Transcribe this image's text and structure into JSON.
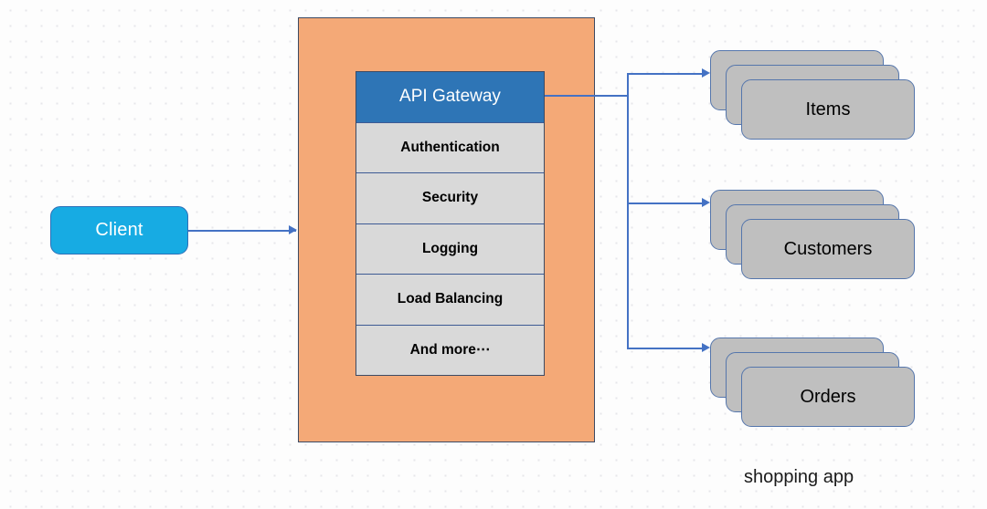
{
  "diagram": {
    "caption": "shopping app",
    "colors": {
      "background": "#fdfdfd",
      "grid_dot": "#e6e6ea",
      "client_fill": "#17ABE3",
      "container_fill": "#F4A977",
      "container_border": "#3d4a63",
      "header_fill": "#2E75B6",
      "cell_fill": "#d9d9d9",
      "service_fill": "#BFBFBF",
      "service_border": "#5576ac",
      "connector": "#4472C4",
      "text_light": "#ffffff",
      "text_dark": "#000000"
    }
  },
  "client": {
    "label": "Client"
  },
  "gateway": {
    "cells": [
      {
        "label": "API Gateway",
        "role": "header"
      },
      {
        "label": "Authentication",
        "role": "feature"
      },
      {
        "label": "Security",
        "role": "feature"
      },
      {
        "label": "Logging",
        "role": "feature"
      },
      {
        "label": "Load Balancing",
        "role": "feature"
      },
      {
        "label": "And more⋯",
        "role": "feature"
      }
    ]
  },
  "services": [
    {
      "label": "Items"
    },
    {
      "label": "Customers"
    },
    {
      "label": "Orders"
    }
  ],
  "connectors": [
    {
      "name": "client-to-gateway",
      "from": "Client",
      "to": "API Gateway",
      "arrow": true
    },
    {
      "name": "gateway-to-items",
      "from": "API Gateway",
      "to": "Items",
      "arrow": true
    },
    {
      "name": "gateway-to-customers",
      "from": "API Gateway",
      "to": "Customers",
      "arrow": true
    },
    {
      "name": "gateway-to-orders",
      "from": "API Gateway",
      "to": "Orders",
      "arrow": true
    }
  ]
}
